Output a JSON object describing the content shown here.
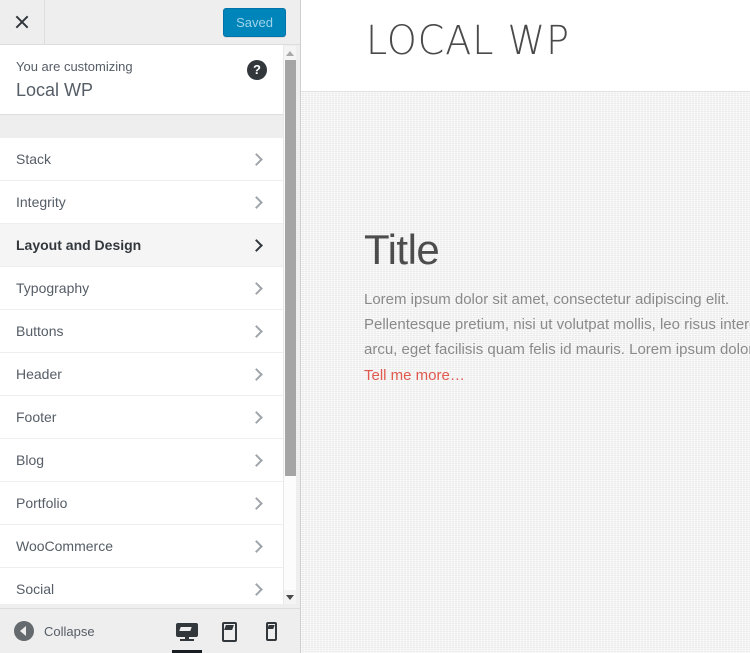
{
  "customizer": {
    "close_label": "Close",
    "close_icon": "close-icon",
    "save_button_label": "Saved",
    "info": {
      "eyebrow": "You are customizing",
      "title": "Local WP",
      "help_icon": "help-icon",
      "help_label": "?"
    },
    "panels": [
      {
        "label": "Stack",
        "active": false
      },
      {
        "label": "Integrity",
        "active": false
      },
      {
        "label": "Layout and Design",
        "active": true
      },
      {
        "label": "Typography",
        "active": false
      },
      {
        "label": "Buttons",
        "active": false
      },
      {
        "label": "Header",
        "active": false
      },
      {
        "label": "Footer",
        "active": false
      },
      {
        "label": "Blog",
        "active": false
      },
      {
        "label": "Portfolio",
        "active": false
      },
      {
        "label": "WooCommerce",
        "active": false
      },
      {
        "label": "Social",
        "active": false
      }
    ],
    "footer": {
      "collapse_label": "Collapse",
      "collapse_icon": "collapse-arrow-icon",
      "devices": [
        {
          "name": "desktop",
          "icon": "desktop-icon",
          "active": true
        },
        {
          "name": "tablet",
          "icon": "tablet-icon",
          "active": false
        },
        {
          "name": "mobile",
          "icon": "mobile-icon",
          "active": false
        }
      ]
    },
    "scrollbar": {
      "up_icon": "scroll-up-arrow-icon",
      "down_icon": "scroll-down-arrow-icon"
    },
    "colors": {
      "save_button_bg": "#0085ba",
      "sidebar_bg": "#eeeeee",
      "active_item_bg": "#f5f5f5",
      "text": "#555d66"
    }
  },
  "preview": {
    "site_title": "LOCAL WP",
    "content": {
      "heading": "Title",
      "paragraph_lines": [
        "Lorem ipsum dolor sit amet, consectetur adipiscing elit.",
        "Pellentesque pretium, nisi ut volutpat mollis, leo risus interdum",
        "arcu, eget facilisis quam felis id mauris. Lorem ipsum dolor sit"
      ],
      "link_label": "Tell me more…"
    },
    "colors": {
      "link": "#e0594e",
      "body_bg": "#f2f2f2"
    }
  }
}
